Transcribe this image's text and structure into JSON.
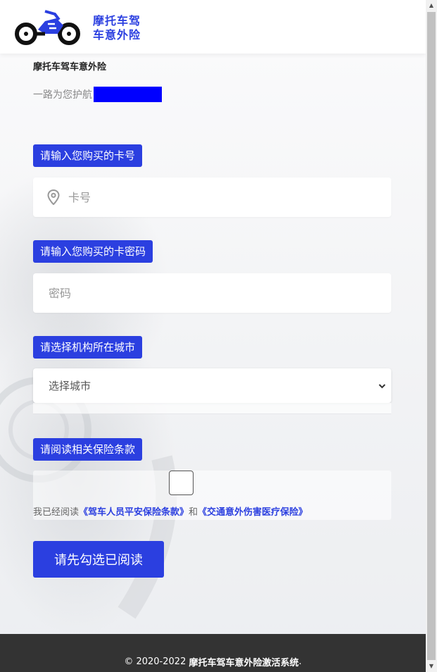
{
  "header": {
    "logo_line1": "摩托车驾",
    "logo_line2": "车意外险",
    "brand_color": "#2b3fe0"
  },
  "intro": {
    "title": "摩托车驾车意外险",
    "tagline": "一路为您护航"
  },
  "form": {
    "card_label": "请输入您购买的卡号",
    "card_placeholder": "卡号",
    "password_label": "请输入您购买的卡密码",
    "password_placeholder": "密码",
    "city_label": "请选择机构所在城市",
    "city_select": "选择城市",
    "terms_label": "请阅读相关保险条款",
    "terms_prefix": "我已经阅读",
    "terms_link1": "《驾车人员平安保险条款》",
    "terms_and": "和",
    "terms_link2": "《交通意外伤害医疗保险》",
    "terms_checked": false,
    "submit_label": "请先勾选已阅读"
  },
  "footer": {
    "copyright_prefix": "© 2020-2022",
    "copyright_name": "摩托车驾车意外险激活系统",
    "copyright_suffix": "."
  },
  "icons": {
    "location": "location-pin-icon",
    "chevron": "chevron-down-icon"
  }
}
